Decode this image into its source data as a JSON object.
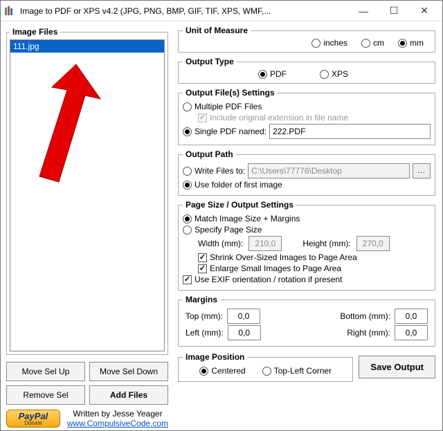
{
  "window": {
    "title": "Image to PDF or XPS  v4.2   (JPG, PNG, BMP, GIF, TIF, XPS, WMF,..."
  },
  "leftPanel": {
    "legend": "Image Files",
    "files": [
      "111.jpg"
    ],
    "moveUp": "Move Sel Up",
    "moveDown": "Move Sel Down",
    "removeSel": "Remove Sel",
    "addFiles": "Add Files"
  },
  "credits": {
    "paypalMain": "PayPal",
    "paypalSub": "Donate",
    "writtenBy": "Written by Jesse Yeager",
    "site": "www.CompulsiveCode.com"
  },
  "unit": {
    "legend": "Unit of Measure",
    "inches": "inches",
    "cm": "cm",
    "mm": "mm",
    "selected": "mm"
  },
  "outputType": {
    "legend": "Output Type",
    "pdf": "PDF",
    "xps": "XPS",
    "selected": "pdf"
  },
  "outputFiles": {
    "legend": "Output File(s) Settings",
    "multiple": "Multiple PDF Files",
    "includeExt": "Include original extension in file name",
    "single": "Single PDF named:",
    "singleValue": "222.PDF",
    "selected": "single",
    "includeExtChecked": true
  },
  "outputPath": {
    "legend": "Output Path",
    "writeTo": "Write Files to:",
    "writeToValue": "C:\\Users\\77776\\Desktop",
    "useFolder": "Use folder of first image",
    "selected": "useFolder"
  },
  "pageSize": {
    "legend": "Page Size / Output Settings",
    "matchImage": "Match Image Size + Margins",
    "specify": "Specify Page Size",
    "selected": "matchImage",
    "widthLabel": "Width (mm):",
    "widthValue": "210,0",
    "heightLabel": "Height (mm):",
    "heightValue": "270,0",
    "shrink": "Shrink Over-Sized Images to Page Area",
    "shrinkChecked": true,
    "enlarge": "Enlarge Small Images to Page Area",
    "enlargeChecked": true,
    "useExif": "Use EXIF orientation / rotation if present",
    "useExifChecked": true
  },
  "margins": {
    "legend": "Margins",
    "topLabel": "Top (mm):",
    "topValue": "0,0",
    "bottomLabel": "Bottom (mm):",
    "bottomValue": "0,0",
    "leftLabel": "Left (mm):",
    "leftValue": "0,0",
    "rightLabel": "Right (mm):",
    "rightValue": "0,0"
  },
  "imagePos": {
    "legend": "Image Position",
    "centered": "Centered",
    "topLeft": "Top-Left Corner",
    "selected": "centered"
  },
  "saveOutput": "Save Output"
}
